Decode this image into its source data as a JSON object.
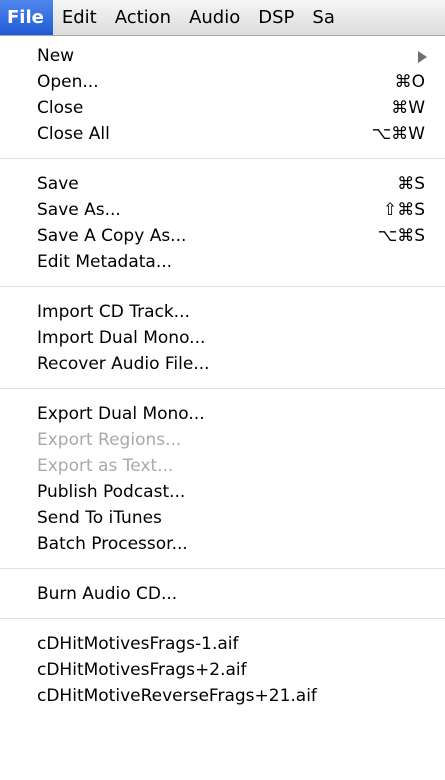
{
  "menubar": {
    "items": [
      {
        "label": "File"
      },
      {
        "label": "Edit"
      },
      {
        "label": "Action"
      },
      {
        "label": "Audio"
      },
      {
        "label": "DSP"
      },
      {
        "label": "Sa"
      }
    ]
  },
  "file_menu": {
    "new": {
      "label": "New"
    },
    "open": {
      "label": "Open...",
      "shortcut": "⌘O"
    },
    "close": {
      "label": "Close",
      "shortcut": "⌘W"
    },
    "close_all": {
      "label": "Close All",
      "shortcut": "⌥⌘W"
    },
    "save": {
      "label": "Save",
      "shortcut": "⌘S"
    },
    "save_as": {
      "label": "Save As...",
      "shortcut": "⇧⌘S"
    },
    "save_copy_as": {
      "label": "Save A Copy As...",
      "shortcut": "⌥⌘S"
    },
    "edit_metadata": {
      "label": "Edit Metadata..."
    },
    "import_cd_track": {
      "label": "Import CD Track..."
    },
    "import_dual_mono": {
      "label": "Import Dual Mono..."
    },
    "recover_audio_file": {
      "label": "Recover Audio File..."
    },
    "export_dual_mono": {
      "label": "Export Dual Mono..."
    },
    "export_regions": {
      "label": "Export Regions...",
      "enabled": false
    },
    "export_as_text": {
      "label": "Export as Text...",
      "enabled": false
    },
    "publish_podcast": {
      "label": "Publish Podcast..."
    },
    "send_to_itunes": {
      "label": "Send To iTunes"
    },
    "batch_processor": {
      "label": "Batch Processor..."
    },
    "burn_audio_cd": {
      "label": "Burn Audio CD..."
    },
    "recent_files": [
      {
        "label": "cDHitMotivesFrags-1.aif"
      },
      {
        "label": "cDHitMotivesFrags+2.aif"
      },
      {
        "label": "cDHitMotiveReverseFrags+21.aif"
      }
    ]
  },
  "colors": {
    "accent": "#2f66dc",
    "disabled_text": "#a9a9a9"
  }
}
